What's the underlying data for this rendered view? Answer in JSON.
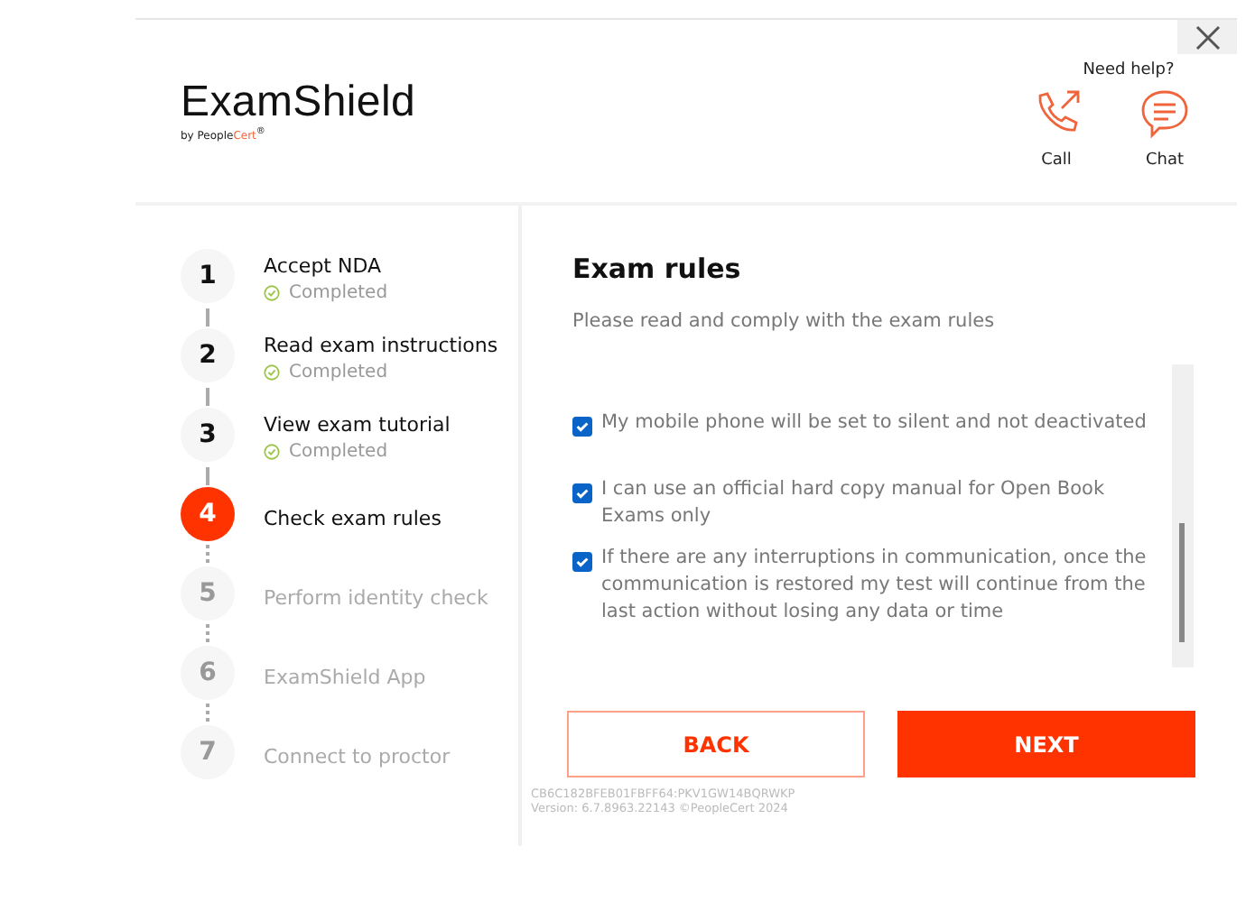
{
  "header": {
    "logo": "ExamShield",
    "logo_by": "by People",
    "logo_brand": "Cert",
    "logo_mark": "®",
    "help_title": "Need help?",
    "help_actions": [
      {
        "label": "Call",
        "kind": "call"
      },
      {
        "label": "Chat",
        "kind": "chat"
      }
    ]
  },
  "steps": [
    {
      "number": "1",
      "label": "Accept NDA",
      "completed": true,
      "current": false,
      "status_text": "Completed"
    },
    {
      "number": "2",
      "label": "Read exam instructions",
      "completed": true,
      "current": false,
      "status_text": "Completed"
    },
    {
      "number": "3",
      "label": "View exam tutorial",
      "completed": true,
      "current": false,
      "status_text": "Completed"
    },
    {
      "number": "4",
      "label": "Check exam rules",
      "completed": false,
      "current": true
    },
    {
      "number": "5",
      "label": "Perform identity check",
      "completed": false,
      "current": false
    },
    {
      "number": "6",
      "label": "ExamShield App",
      "completed": false,
      "current": false
    },
    {
      "number": "7",
      "label": "Connect to proctor",
      "completed": false,
      "current": false
    }
  ],
  "content": {
    "title": "Exam rules",
    "subtitle": "Please read and comply with the exam rules",
    "rules": [
      {
        "text": "My mobile phone will be set to silent and not deactivated",
        "checked": true
      },
      {
        "text": "I can use an official hard copy manual for Open Book Exams only",
        "checked": true
      },
      {
        "text": "If there are any interruptions in communication, once the communication is restored my test will continue from the last action without losing any data or time",
        "checked": true
      }
    ],
    "buttons": [
      {
        "label": "BACK",
        "kind": "secondary"
      },
      {
        "label": "NEXT",
        "kind": "primary"
      }
    ],
    "device_id": "CB6C182BFEB01FBFF64:PKV1GW14BQRWKP",
    "version": "Version: 6.7.8963.22143 ©PeopleCert 2024"
  }
}
